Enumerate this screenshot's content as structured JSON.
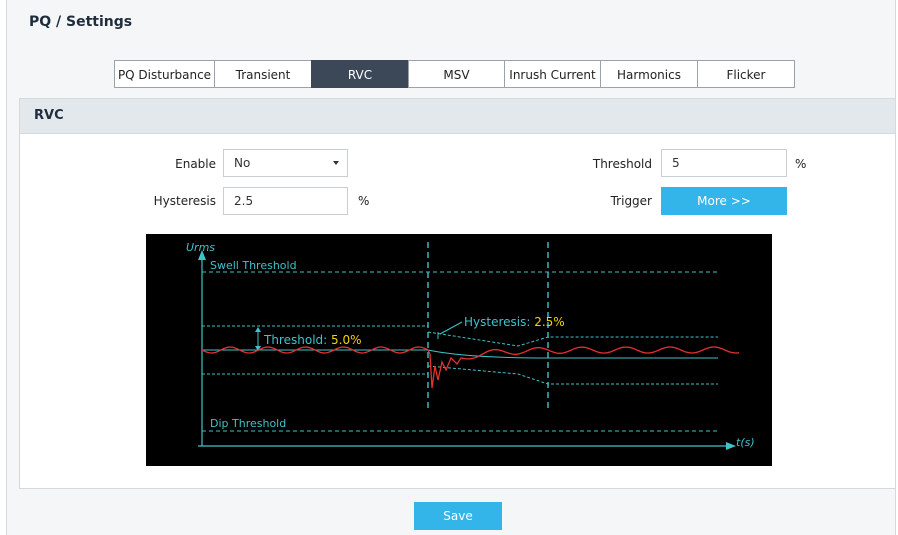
{
  "header": {
    "title": "PQ / Settings"
  },
  "tabs": [
    {
      "label": "PQ Disturbance",
      "active": false
    },
    {
      "label": "Transient",
      "active": false
    },
    {
      "label": "RVC",
      "active": true
    },
    {
      "label": "MSV",
      "active": false
    },
    {
      "label": "Inrush Current",
      "active": false
    },
    {
      "label": "Harmonics",
      "active": false
    },
    {
      "label": "Flicker",
      "active": false
    }
  ],
  "panel": {
    "title": "RVC",
    "enable": {
      "label": "Enable",
      "value": "No"
    },
    "hysteresis": {
      "label": "Hysteresis",
      "value": "2.5",
      "unit": "%"
    },
    "threshold": {
      "label": "Threshold",
      "value": "5",
      "unit": "%"
    },
    "trigger": {
      "label": "Trigger",
      "button": "More >>"
    }
  },
  "diagram": {
    "y_axis": "Urms",
    "x_axis": "t(s)",
    "swell_label": "Swell Threshold",
    "dip_label": "Dip Threshold",
    "threshold_label": "Threshold: ",
    "threshold_value": "5.0%",
    "hysteresis_label": "Hysteresis: ",
    "hysteresis_value": "2.5%"
  },
  "footer": {
    "save": "Save"
  },
  "colors": {
    "accent": "#33b5ea",
    "tab_active": "#3c4858",
    "trace": "#e53030",
    "guide": "#3fc3c8",
    "highlight": "#f5d400"
  }
}
